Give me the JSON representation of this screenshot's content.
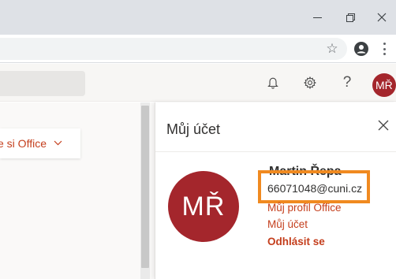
{
  "header": {
    "avatar_initials": "MŘ"
  },
  "page": {
    "office_dropdown_label": "e si Office"
  },
  "account_panel": {
    "title": "Můj účet",
    "avatar_initials": "MŘ",
    "user_name": "Martin Řepa",
    "email": "66071048@cuni.cz",
    "links": {
      "profile": "Můj profil Office",
      "account": "Můj účet",
      "sign_out": "Odhlásit se"
    }
  },
  "colors": {
    "accent": "#c43e1c",
    "avatar_bg": "#a4262c",
    "highlight": "#f08a20"
  }
}
